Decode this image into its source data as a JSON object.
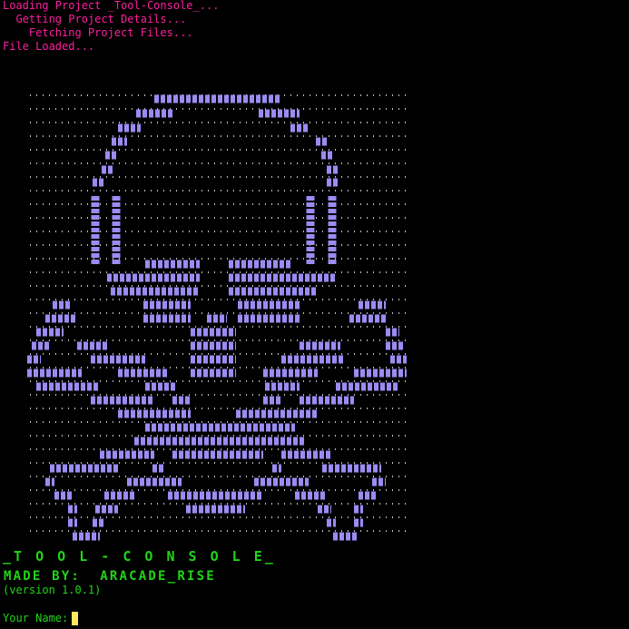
{
  "loading_lines": [
    "Loading Project _Tool-Console_...",
    "  Getting Project Details...",
    "    Fetching Project Files...",
    "File Loaded..."
  ],
  "banner_text": "_T O O L - C O N S O L E_",
  "made_by": "MADE BY:  ARACADE_RISE",
  "version": "(version 1.0.1)",
  "prompt_label": "Your Name:",
  "art": {
    "dot_glyph": "'",
    "block_glyph": "¶",
    "dot_color": "#bdbdbd",
    "block_color": "#9a8cf2"
  },
  "colors": {
    "loading": "#ff1fa0",
    "text_green": "#22d418",
    "cursor": "#ffe760"
  }
}
